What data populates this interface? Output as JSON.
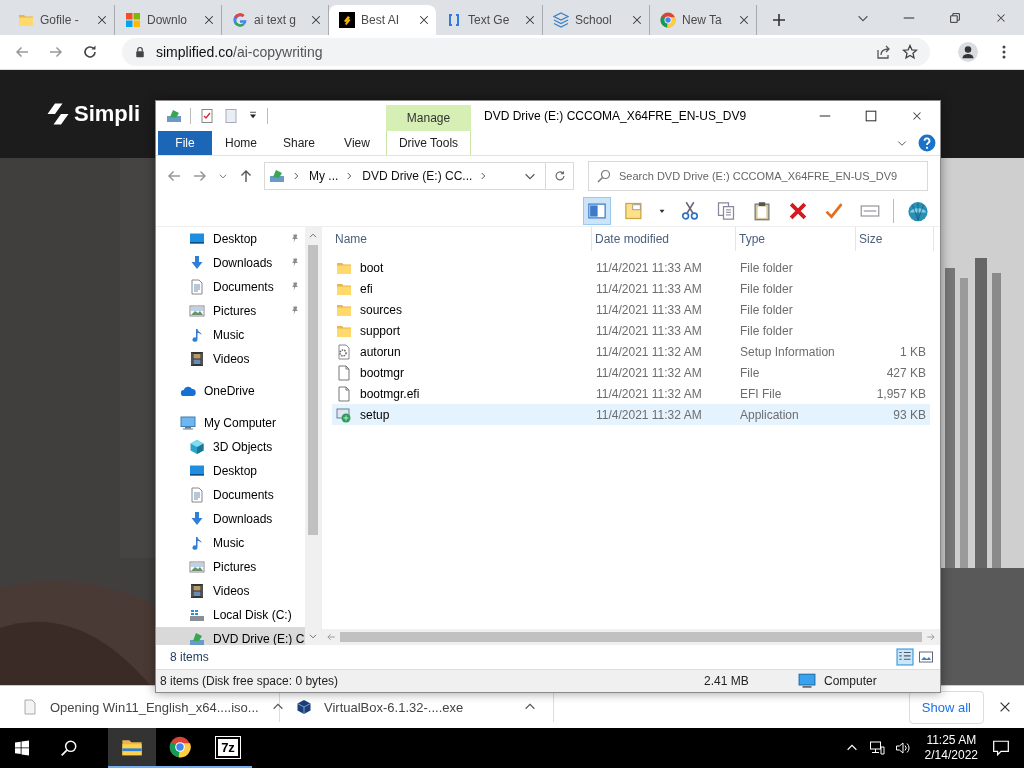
{
  "browser": {
    "tabs": [
      {
        "title": "Gofile -",
        "kind": "folder",
        "selected": false
      },
      {
        "title": "Downlo",
        "kind": "windows",
        "selected": false
      },
      {
        "title": "ai text g",
        "kind": "google",
        "selected": false
      },
      {
        "title": "Best AI",
        "kind": "simplified",
        "selected": true
      },
      {
        "title": "Text Ge",
        "kind": "brackets",
        "selected": false
      },
      {
        "title": "School",
        "kind": "stack",
        "selected": false
      },
      {
        "title": "New Ta",
        "kind": "chrome",
        "selected": false
      }
    ],
    "url_host": "simplified.co",
    "url_path": "/ai-copywriting"
  },
  "website": {
    "logo": "Simpli"
  },
  "explorer": {
    "title": "DVD Drive (E:) CCCOMA_X64FRE_EN-US_DV9",
    "context_header": "Manage",
    "ribbon_tabs": [
      {
        "label": "File",
        "kind": "file"
      },
      {
        "label": "Home",
        "kind": "tab"
      },
      {
        "label": "Share",
        "kind": "tab"
      },
      {
        "label": "View",
        "kind": "tab"
      },
      {
        "label": "Drive Tools",
        "kind": "context"
      }
    ],
    "breadcrumbs": [
      "My ...",
      "DVD Drive (E:) CC..."
    ],
    "search_placeholder": "Search DVD Drive (E:) CCCOMA_X64FRE_EN-US_DV9",
    "nav": {
      "quick_access": [
        {
          "label": "Desktop",
          "kind": "desktop",
          "pinned": true,
          "selected": false
        },
        {
          "label": "Downloads",
          "kind": "downloads",
          "pinned": true,
          "selected": false
        },
        {
          "label": "Documents",
          "kind": "documents",
          "pinned": true,
          "selected": false
        },
        {
          "label": "Pictures",
          "kind": "pictures",
          "pinned": true,
          "selected": false
        },
        {
          "label": "Music",
          "kind": "music",
          "pinned": false,
          "selected": false
        },
        {
          "label": "Videos",
          "kind": "videos",
          "pinned": false,
          "selected": false
        }
      ],
      "items": [
        {
          "label": "OneDrive",
          "kind": "cloud",
          "selected": false
        },
        {
          "label": "My Computer",
          "kind": "computer",
          "selected": false,
          "children": [
            {
              "label": "3D Objects",
              "kind": "cube",
              "selected": false
            },
            {
              "label": "Desktop",
              "kind": "desktop",
              "selected": false
            },
            {
              "label": "Documents",
              "kind": "documents",
              "selected": false
            },
            {
              "label": "Downloads",
              "kind": "downloads",
              "selected": false
            },
            {
              "label": "Music",
              "kind": "music",
              "selected": false
            },
            {
              "label": "Pictures",
              "kind": "pictures",
              "selected": false
            },
            {
              "label": "Videos",
              "kind": "videos",
              "selected": false
            },
            {
              "label": "Local Disk (C:)",
              "kind": "disk",
              "selected": false
            },
            {
              "label": "DVD Drive (E:) C",
              "kind": "dvd",
              "selected": true
            }
          ]
        }
      ]
    },
    "columns": [
      "Name",
      "Date modified",
      "Type",
      "Size"
    ],
    "files": [
      {
        "name": "boot",
        "date": "11/4/2021 11:33 AM",
        "type": "File folder",
        "kind": "folder",
        "selected": false
      },
      {
        "name": "efi",
        "date": "11/4/2021 11:33 AM",
        "type": "File folder",
        "kind": "folder",
        "selected": false
      },
      {
        "name": "sources",
        "date": "11/4/2021 11:33 AM",
        "type": "File folder",
        "kind": "folder",
        "selected": false
      },
      {
        "name": "support",
        "date": "11/4/2021 11:33 AM",
        "type": "File folder",
        "kind": "folder",
        "selected": false
      },
      {
        "name": "autorun",
        "date": "11/4/2021 11:32 AM",
        "type": "Setup Information",
        "size": "1 KB",
        "kind": "inf",
        "selected": false
      },
      {
        "name": "bootmgr",
        "date": "11/4/2021 11:32 AM",
        "type": "File",
        "size": "427 KB",
        "kind": "file",
        "selected": false
      },
      {
        "name": "bootmgr.efi",
        "date": "11/4/2021 11:32 AM",
        "type": "EFI File",
        "size": "1,957 KB",
        "kind": "file",
        "selected": false
      },
      {
        "name": "setup",
        "date": "11/4/2021 11:32 AM",
        "type": "Application",
        "size": "93 KB",
        "kind": "app",
        "selected": true
      }
    ],
    "item_count": "8 items",
    "status": {
      "text": "8 items (Disk free space: 0 bytes)",
      "size": "2.41 MB",
      "location": "Computer"
    }
  },
  "downloads": {
    "items": [
      {
        "name": "Opening Win11_English_x64....iso...",
        "kind": "document"
      },
      {
        "name": "VirtualBox-6.1.32-....exe",
        "kind": "box"
      }
    ],
    "show_all": "Show all"
  },
  "taskbar": {
    "apps": [
      {
        "kind": "explorer",
        "active": true
      },
      {
        "kind": "chrome",
        "active": false
      },
      {
        "kind": "archiver",
        "label": "7z",
        "active": false
      }
    ],
    "time": "11:25 AM",
    "date": "2/14/2022"
  }
}
